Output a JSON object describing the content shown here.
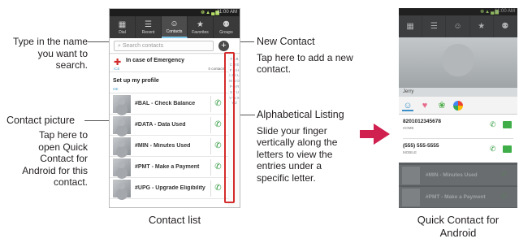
{
  "callouts": {
    "search": {
      "text": "Type in the name you want to search."
    },
    "new_contact": {
      "title": "New Contact",
      "desc": "Tap here to add a new contact."
    },
    "contact_picture": {
      "title": "Contact picture",
      "desc": "Tap here to open Quick Contact for Android for this contact."
    },
    "alphabetical": {
      "title": "Alphabetical Listing",
      "desc": "Slide your finger vertically along the letters to view the entries under a specific letter."
    }
  },
  "captions": {
    "contact_list": "Contact list",
    "quick_contact": "Quick Contact for Android"
  },
  "phone_list": {
    "status": {
      "icons": "❁▲▄▆",
      "time": "11:00 AM"
    },
    "tabs": [
      {
        "label": "Dial",
        "icon": "keypad-icon",
        "glyph": "▦"
      },
      {
        "label": "Recent",
        "icon": "recent-list-icon",
        "glyph": "☰"
      },
      {
        "label": "Contacts",
        "icon": "contacts-icon",
        "glyph": "☺"
      },
      {
        "label": "Favorites",
        "icon": "star-icon",
        "glyph": "★"
      },
      {
        "label": "Groups",
        "icon": "groups-icon",
        "glyph": "⚉"
      }
    ],
    "search_placeholder": "Search contacts",
    "add_glyph": "+",
    "emergency": {
      "label": "In case of Emergency",
      "sub": "ICE",
      "count": "0 contacts"
    },
    "profile": {
      "label": "Set up my profile",
      "sub": "ME"
    },
    "contacts": [
      {
        "name": "#BAL - Check Balance"
      },
      {
        "name": "#DATA - Data Used"
      },
      {
        "name": "#MIN - Minutes Used"
      },
      {
        "name": "#PMT - Make a Payment"
      },
      {
        "name": "#UPG - Upgrade Eligibility"
      }
    ],
    "alphabet": "# A B C D E F G H I J K L M N O P Q R S T U V W X Y Z"
  },
  "phone_quick": {
    "status": {
      "icons": "❁▲▄▆",
      "time": "11:00 AM"
    },
    "contact_name": "Jerry",
    "numbers": [
      {
        "number": "8201012345678",
        "type": "HOME"
      },
      {
        "number": "(555) 555-5555",
        "type": "MOBILE"
      }
    ],
    "dim_rows": [
      {
        "name": "#MIN - Minutes Used"
      },
      {
        "name": "#PMT - Make a Payment"
      }
    ]
  },
  "colors": {
    "highlight_box": "#d42b2b",
    "arrow": "#d0204f",
    "call_green": "#2f9a3d"
  }
}
